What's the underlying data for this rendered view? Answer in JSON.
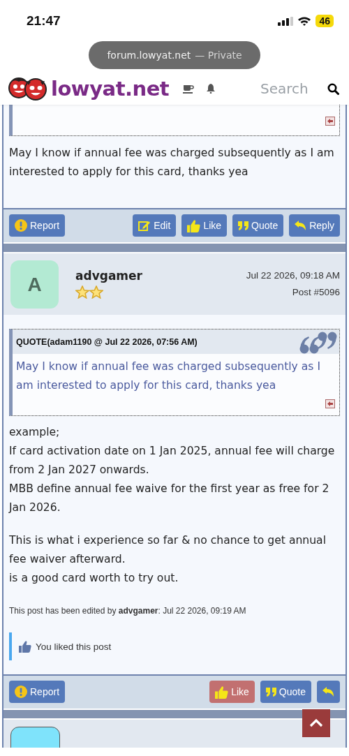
{
  "status_bar": {
    "time": "21:47",
    "battery": "46"
  },
  "address_pill": {
    "domain": "forum.lowyat.net",
    "mode": "— Private"
  },
  "header": {
    "logo": "lowyat.net",
    "search": {
      "placeholder": "Search"
    }
  },
  "posts": [
    {
      "kind": "continued",
      "body": [
        "May I know if annual fee was charged subsequently as I am interested to apply for this card, thanks yea"
      ],
      "buttons": [
        {
          "kind": "report",
          "label": "Report"
        },
        {
          "kind": "edit",
          "label": "Edit"
        },
        {
          "kind": "like",
          "label": "Like",
          "liked": false
        },
        {
          "kind": "quote",
          "label": "Quote"
        },
        {
          "kind": "reply",
          "label": "Reply"
        }
      ]
    },
    {
      "kind": "full",
      "author": {
        "name": "advgamer",
        "initial": "A"
      },
      "date": "Jul 22 2026, 09:18 AM",
      "number": "Post #5096",
      "quote": {
        "header": "QUOTE(adam1190 @ Jul 22 2026, 07:56 AM)",
        "text": "May I know if annual fee was charged subsequently as I am interested to apply for this card, thanks yea"
      },
      "paragraphs": [
        [
          "example;",
          "If card activation date on 1 Jan 2025, annual fee will charge from 2 Jan 2027 onwards.",
          "MBB define annual fee waive for the first year as free for 2 Jan 2026."
        ],
        [
          "This is what i experience so far & no chance to get annual fee waiver afterward.",
          "is a good card worth to try out."
        ]
      ],
      "edited": "This post has been edited by **advgamer**: Jul 22 2026, 09:19 AM",
      "liked_note": "You liked this post",
      "buttons": [
        {
          "kind": "report",
          "label": "Report"
        },
        {
          "kind": "like",
          "label": "Like",
          "liked": true
        },
        {
          "kind": "quote",
          "label": "Quote"
        },
        {
          "kind": "reply"
        }
      ]
    },
    {
      "kind": "next"
    }
  ]
}
